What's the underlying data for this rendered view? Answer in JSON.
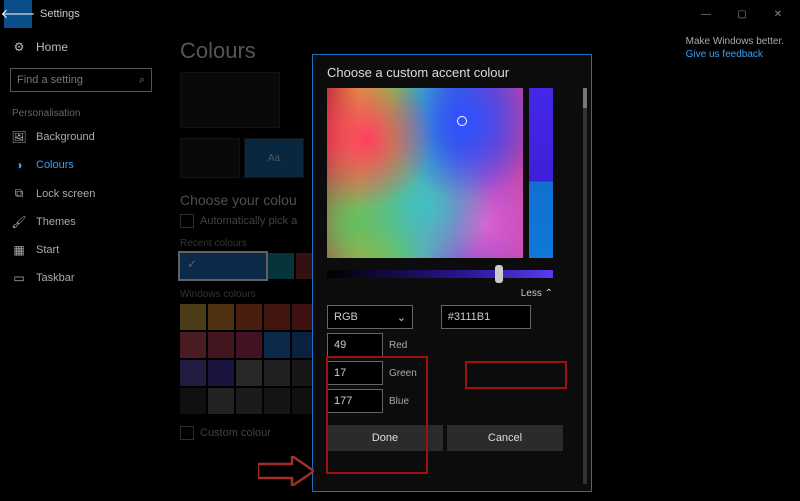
{
  "titlebar": {
    "app": "Settings"
  },
  "sidebar": {
    "home": "Home",
    "search_placeholder": "Find a setting",
    "category": "Personalisation",
    "items": [
      {
        "label": "Background"
      },
      {
        "label": "Colours"
      },
      {
        "label": "Lock screen"
      },
      {
        "label": "Themes"
      },
      {
        "label": "Start"
      },
      {
        "label": "Taskbar"
      }
    ]
  },
  "page": {
    "title": "Colours",
    "preview_aa": "Aa",
    "section_choose": "Choose your colou",
    "auto_pick": "Automatically pick a",
    "recent_label": "Recent colours",
    "recent": [
      "#1e6fbf",
      "#0f8a9a",
      "#8a2a2a",
      "#444444"
    ],
    "windows_label": "Windows colours",
    "palette": [
      "#c0a040",
      "#d08030",
      "#c05028",
      "#b03828",
      "#a83030",
      "#c04858",
      "#b03850",
      "#b03060",
      "#1e6fbf",
      "#1a5aa8",
      "#5a4ab0",
      "#4838a0",
      "#686868",
      "#585858",
      "#3a3a3a",
      "#2a2a2a",
      "#5a5a5a",
      "#484848",
      "#383838",
      "#2a2a2a"
    ],
    "custom_row": "Custom colour"
  },
  "feedback": {
    "line1": "Make Windows better.",
    "link": "Give us feedback"
  },
  "dialog": {
    "title": "Choose a custom accent colour",
    "less": "Less",
    "mode": "RGB",
    "red_label": "Red",
    "green_label": "Green",
    "blue_label": "Blue",
    "red": "49",
    "green": "17",
    "blue": "177",
    "hex": "#3111B1",
    "done": "Done",
    "cancel": "Cancel"
  }
}
